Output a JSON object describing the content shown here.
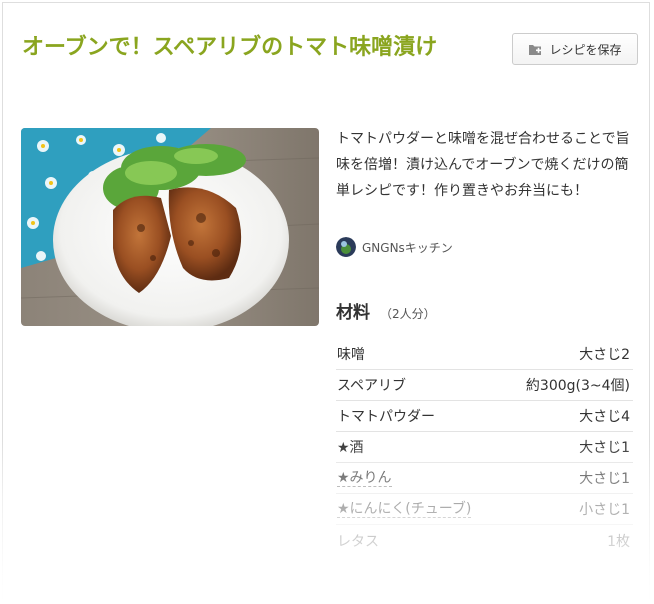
{
  "recipe": {
    "title": "オーブンで！スペアリブのトマト味噌漬け",
    "save_label": "レシピを保存",
    "description": "トマトパウダーと味噌を混ぜ合わせることで旨味を倍増！漬け込んでオーブンで焼くだけの簡単レシピです！作り置きやお弁当にも！",
    "author": "GNGNsキッチン"
  },
  "ingredients": {
    "title": "材料",
    "servings": "（2人分）",
    "items": [
      {
        "name": "味噌",
        "amount": "大さじ2"
      },
      {
        "name": "スペアリブ",
        "amount": "約300g(3~4個)"
      },
      {
        "name": "トマトパウダー",
        "amount": "大さじ4"
      },
      {
        "name": "★酒",
        "amount": "大さじ1"
      },
      {
        "name": "★みりん",
        "amount": "大さじ1"
      },
      {
        "name": "★にんにく(チューブ)",
        "amount": "小さじ1"
      },
      {
        "name": "レタス",
        "amount": "1枚"
      }
    ]
  },
  "colors": {
    "title": "#8aa51f",
    "text": "#333333",
    "border": "#e3e3e3"
  },
  "icons": {
    "save": "folder-plus-icon",
    "author": "avatar"
  }
}
